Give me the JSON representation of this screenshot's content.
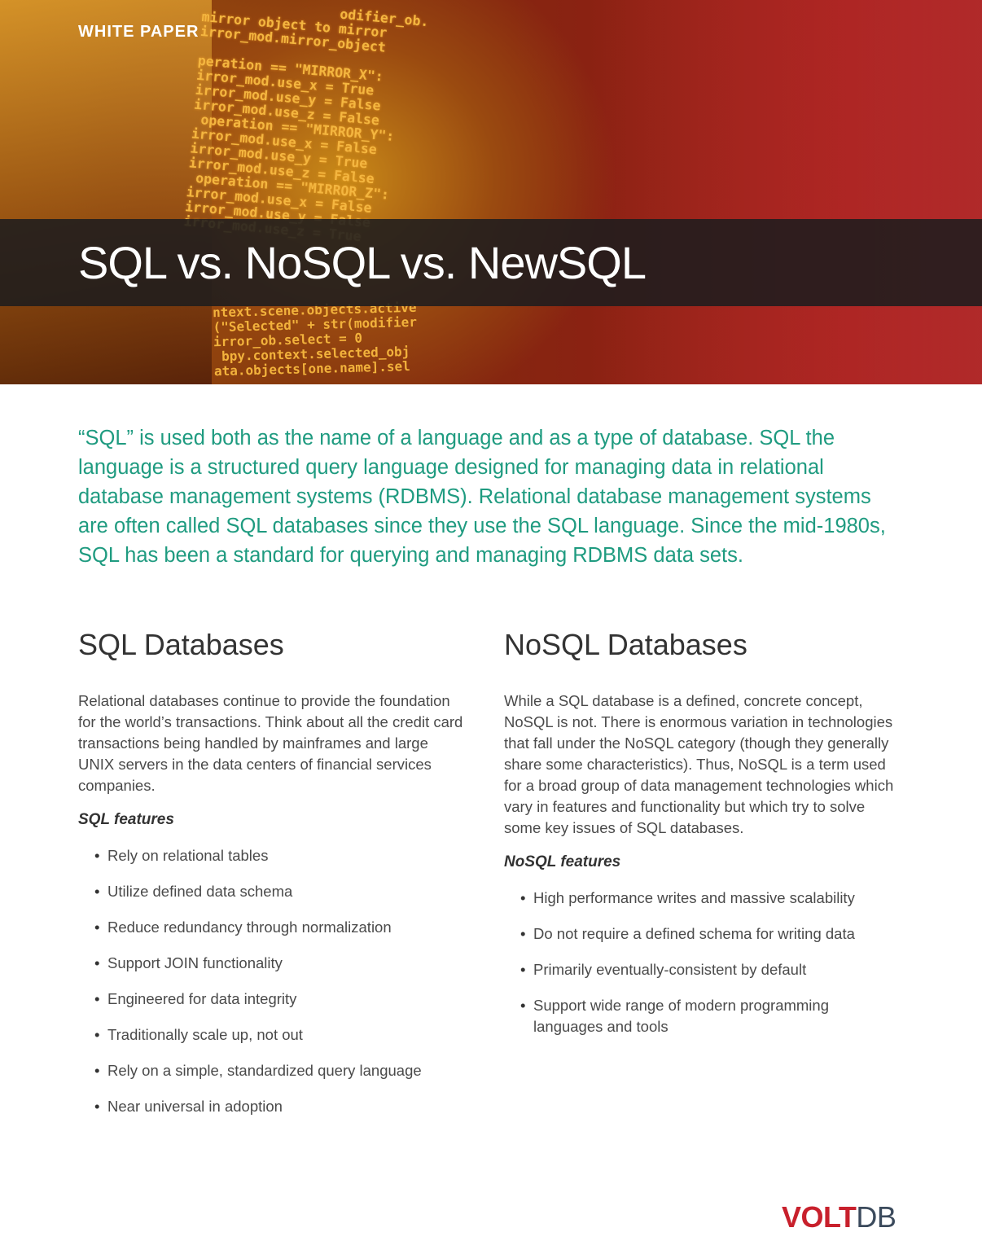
{
  "header": {
    "label": "WHITE PAPER",
    "title": "SQL vs. NoSQL vs. NewSQL",
    "code_lines_top": [
      "                 odifier_ob.",
      "mirror object to mirror",
      "irror_mod.mirror_object",
      "",
      "peration == \"MIRROR_X\":",
      "irror_mod.use_x = True",
      "irror_mod.use_y = False",
      "irror_mod.use_z = False",
      " operation == \"MIRROR_Y\":",
      "irror_mod.use_x = False",
      "irror_mod.use_y = True",
      "irror_mod.use_z = False",
      " operation == \"MIRROR_Z\":",
      "irror_mod.use_x = False",
      "irror_mod.use_y = False",
      "irror_mod.use_z = True"
    ],
    "code_lines_bottom": [
      "ntext.scene.objects.active",
      "(\"Selected\" + str(modifier",
      "irror_ob.select = 0",
      " bpy.context.selected_obj",
      "ata.objects[one.name].sel"
    ]
  },
  "intro_lines": [
    "“SQL” is used both as the name of a language and as a type of database. SQL the",
    "language is a structured query language designed for managing data in relational",
    "database management systems (RDBMS). Relational database management systems",
    "are often called SQL databases since they use the SQL language. Since the mid-1980s,",
    "SQL has been a standard for querying and managing RDBMS data sets."
  ],
  "sql": {
    "heading": "SQL Databases",
    "body": "Relational databases continue to provide the foundation for the world’s transactions. Think about all the credit card transactions being handled by mainframes and large UNIX servers in the data centers of financial services companies.",
    "features_label": "SQL features",
    "features": [
      "Rely on relational tables",
      "Utilize defined data schema",
      "Reduce redundancy through normalization",
      "Support JOIN functionality",
      "Engineered for data integrity",
      "Traditionally scale up, not out",
      "Rely on a simple, standardized query language",
      "Near universal in adoption"
    ]
  },
  "nosql": {
    "heading": "NoSQL Databases",
    "body": "While a SQL database is a defined, concrete concept, NoSQL is not. There is enormous variation in technologies that fall under the NoSQL category (though they generally share some characteristics). Thus, NoSQL is a term used for a broad group of data management technologies which vary in features and functionality but which try to solve some key issues of SQL databases.",
    "features_label": "NoSQL features",
    "features": [
      "High performance writes and massive scalability",
      "Do not require a defined schema for writing data",
      "Primarily eventually-consistent by default",
      "Support wide range of modern programming languages and tools"
    ]
  },
  "logo": {
    "part1": "VOLT",
    "part2": "DB",
    "colors": {
      "volt": "#c8202c",
      "db": "#3b4a5c"
    }
  },
  "colors": {
    "accent_teal": "#1f9b80"
  }
}
